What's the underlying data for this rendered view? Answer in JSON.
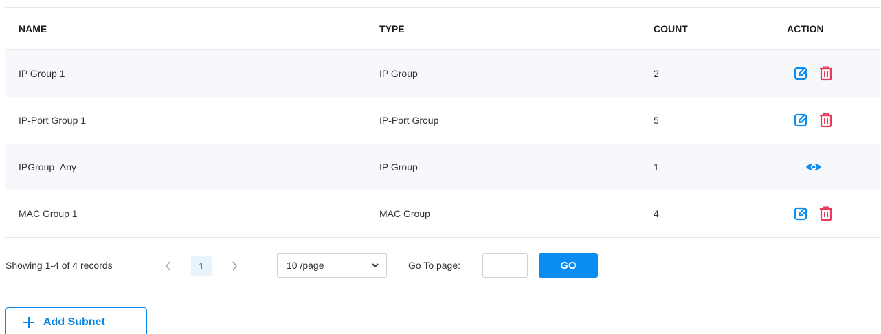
{
  "table": {
    "headers": {
      "name": "NAME",
      "type": "TYPE",
      "count": "COUNT",
      "action": "ACTION"
    },
    "rows": [
      {
        "name": "IP Group 1",
        "type": "IP Group",
        "count": "2",
        "actions": [
          "edit-icon",
          "delete-icon"
        ]
      },
      {
        "name": "IP-Port Group 1",
        "type": "IP-Port Group",
        "count": "5",
        "actions": [
          "edit-icon",
          "delete-icon"
        ]
      },
      {
        "name": "IPGroup_Any",
        "type": "IP Group",
        "count": "1",
        "actions": [
          "view-icon"
        ]
      },
      {
        "name": "MAC Group 1",
        "type": "MAC Group",
        "count": "4",
        "actions": [
          "edit-icon",
          "delete-icon"
        ]
      }
    ]
  },
  "pagination": {
    "showing": "Showing 1-4 of 4 records",
    "current_page": "1",
    "page_size": "10 /page",
    "goto_label": "Go To page:",
    "goto_value": "",
    "go_label": "GO"
  },
  "add_button": {
    "label": "Add Subnet"
  },
  "colors": {
    "accent": "#0a8cf0",
    "delete": "#e8395a",
    "row_stripe": "#f6f8fb"
  }
}
